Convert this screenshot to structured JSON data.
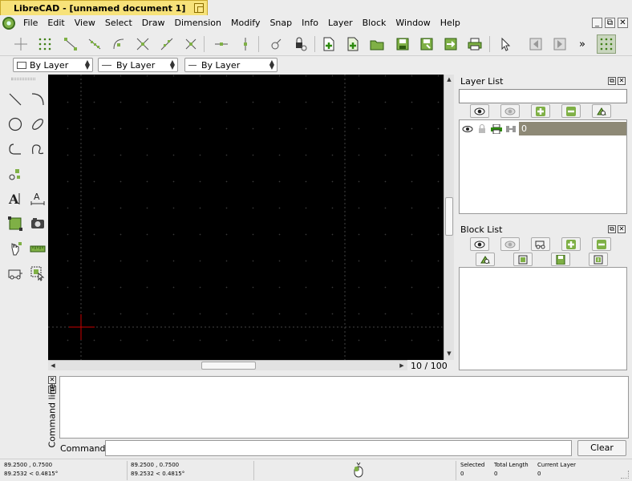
{
  "window": {
    "title": "LibreCAD - [unnamed document 1]"
  },
  "menu": [
    "File",
    "Edit",
    "View",
    "Select",
    "Draw",
    "Dimension",
    "Modify",
    "Snap",
    "Info",
    "Layer",
    "Block",
    "Window",
    "Help"
  ],
  "window_controls": {
    "minimize": "_",
    "restore": "⧉",
    "close": "✕"
  },
  "toolbar": {
    "overflow": "»"
  },
  "pen_toolbar": {
    "color": "By Layer",
    "line_type": "By Layer",
    "line_width": "By Layer"
  },
  "canvas": {
    "zoom": "10 / 100",
    "background": "#000000",
    "crosshair_color": "#cc0000"
  },
  "layer_list": {
    "title": "Layer List",
    "filter_value": "",
    "layers": [
      {
        "name": "0"
      }
    ]
  },
  "block_list": {
    "title": "Block List"
  },
  "command_line": {
    "title": "Command line",
    "label": "Command:",
    "value": "",
    "clear_label": "Clear"
  },
  "status": {
    "abs_coord": "89.2500 , 0.7500",
    "abs_polar": "89.2532 < 0.4815°",
    "rel_coord": "89.2500 , 0.7500",
    "rel_polar": "89.2532 < 0.4815°",
    "selected_label": "Selected",
    "selected_value": "0",
    "total_length_label": "Total Length",
    "total_length_value": "0",
    "current_layer_label": "Current Layer",
    "current_layer_value": "0"
  },
  "colors": {
    "accent_green": "#7fb046",
    "title_tab": "#f7e27a",
    "selected_layer": "#8e8976"
  }
}
